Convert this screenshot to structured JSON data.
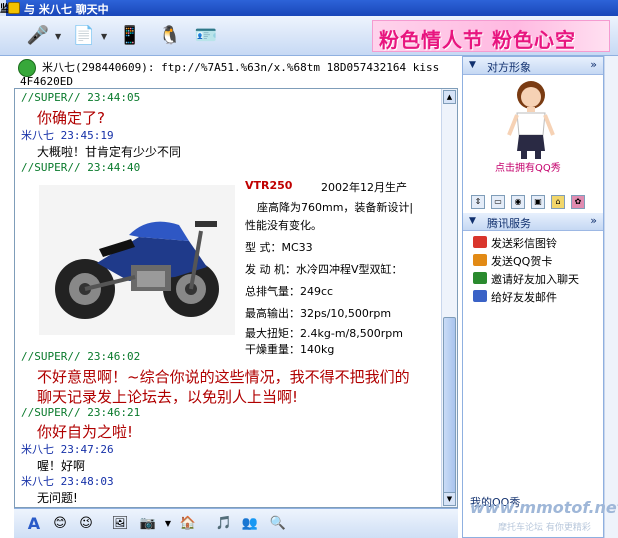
{
  "window": {
    "title": "与 米八七 聊天中",
    "left_edge_char": "监"
  },
  "banner": {
    "text": "粉色情人节 粉色心空"
  },
  "contact": {
    "line1": "米八七(298440609): ftp://%7A51.%63n/x.%68tm 18D057432164  kiss",
    "line2": "4F4620ED"
  },
  "messages": [
    {
      "kind": "super",
      "header": "//SUPER// 23:44:05",
      "body": "你确定了?"
    },
    {
      "kind": "mi",
      "header": "米八七 23:45:19",
      "body": "大概啦！甘肯定有少少不同"
    },
    {
      "kind": "super",
      "header": "//SUPER// 23:44:40",
      "body": ""
    },
    {
      "kind": "super",
      "header": "//SUPER// 23:46:02",
      "body": "不好意思啊！~综合你说的这些情况，我不得不把我们的",
      "body2": "聊天记录发上论坛去，以免别人上当啊!"
    },
    {
      "kind": "super",
      "header": "//SUPER// 23:46:21",
      "body": "你好自为之啦!"
    },
    {
      "kind": "mi",
      "header": "米八七 23:47:26",
      "body": "喔！好啊"
    },
    {
      "kind": "mi",
      "header": "米八七 23:48:03",
      "body": "无问题!"
    }
  ],
  "moto": {
    "model": "VTR250",
    "year": "2002年12月生产",
    "specs": [
      "座高降为760mm，装备新设计|",
      "性能没有变化。",
      "型    式：MC33",
      "发 动 机：水冷四冲程V型双缸：",
      "总排气量：249cc",
      "最高输出：32ps/10,500rpm",
      "最大扭矩：2.4kg-m/8,500rpm",
      "干燥重量：140kg"
    ]
  },
  "side": {
    "show_header": "对方形象",
    "qqshow_link": "点击拥有QQ秀",
    "services_header": "腾讯服务",
    "services": [
      {
        "label": "发送彩信图铃",
        "color": "#d9352c"
      },
      {
        "label": "发送QQ贺卡",
        "color": "#e28a15"
      },
      {
        "label": "邀请好友加入聊天",
        "color": "#2a8a2e"
      },
      {
        "label": "给好友发邮件",
        "color": "#3a62c6"
      }
    ],
    "my_show": "我的QQ秀"
  },
  "watermark": {
    "main": "www.mmotof.net",
    "sub": "摩托车论坛 有你更精彩"
  }
}
